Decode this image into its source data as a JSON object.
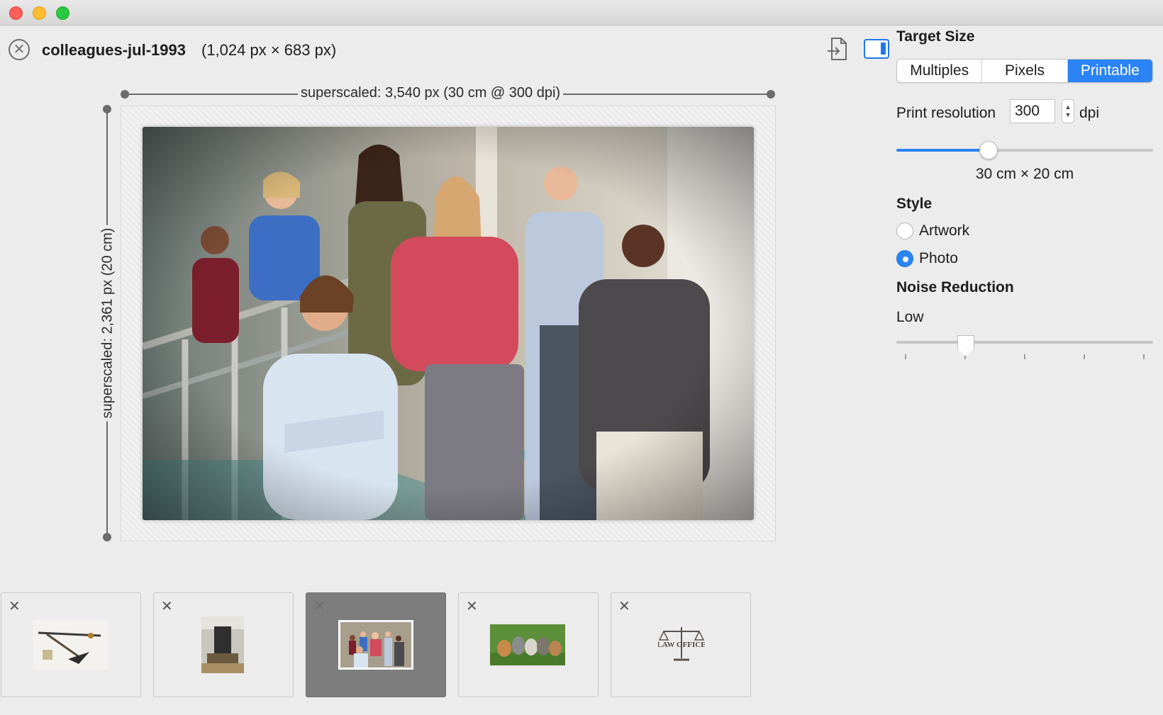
{
  "window": {
    "title": "",
    "accent_color": "#2b84f5"
  },
  "document": {
    "name": "colleagues-jul-1993",
    "dimensions": "(1,024 px × 683 px)"
  },
  "toolbar": {
    "export_icon": "export-icon",
    "sidebar_icon": "sidebar-toggle-icon"
  },
  "canvas": {
    "width_label": "superscaled: 3,540 px (30 cm @ 300 dpi)",
    "height_label": "superscaled: 2,361 px (20 cm)"
  },
  "panel": {
    "target_size_title": "Target Size",
    "segments": [
      {
        "label": "Multiples",
        "active": false
      },
      {
        "label": "Pixels",
        "active": false
      },
      {
        "label": "Printable",
        "active": true
      }
    ],
    "print_resolution_label": "Print resolution",
    "print_resolution_value": "300",
    "print_resolution_unit": "dpi",
    "resolution_slider_fraction": 0.36,
    "print_size": "30 cm × 20 cm",
    "style_title": "Style",
    "style_options": [
      {
        "label": "Artwork",
        "checked": false
      },
      {
        "label": "Photo",
        "checked": true
      }
    ],
    "noise_title": "Noise Reduction",
    "noise_level": "Low",
    "noise_slider_fraction": 0.27
  },
  "thumbnails": [
    {
      "name": "thumb-drawing-tools",
      "active": false,
      "close": "✕"
    },
    {
      "name": "thumb-workshop",
      "active": false,
      "close": "✕"
    },
    {
      "name": "thumb-colleagues",
      "active": true,
      "close": "✕"
    },
    {
      "name": "thumb-kittens",
      "active": false,
      "close": "✕"
    },
    {
      "name": "thumb-law-office",
      "active": false,
      "close": "✕",
      "logo_text": "Law Office"
    }
  ]
}
